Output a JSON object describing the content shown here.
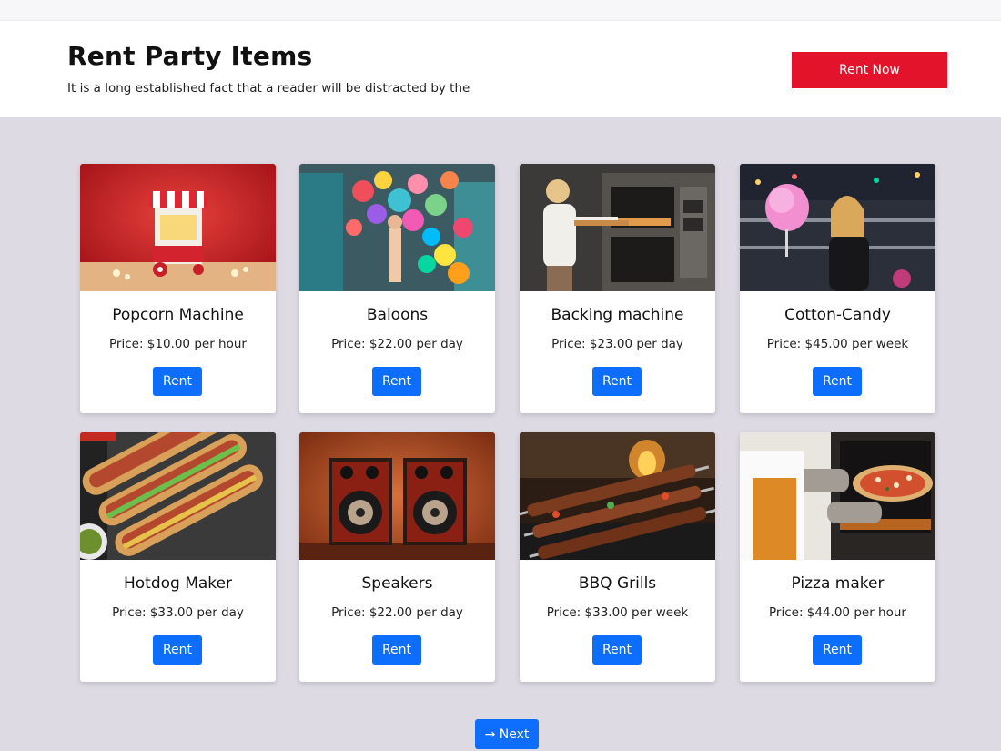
{
  "hero": {
    "title": "Rent Party Items",
    "subtitle": "It is a long established fact that a reader will be distracted by the",
    "cta_label": "Rent Now"
  },
  "colors": {
    "accent_red": "#e3132b",
    "primary_blue": "#0d6efd",
    "page_bg": "#dddae3"
  },
  "items": [
    {
      "name": "Popcorn Machine",
      "price": "Price: $10.00 per hour",
      "button": "Rent",
      "image": "popcorn-machine-photo"
    },
    {
      "name": "Baloons",
      "price": "Price: $22.00 per day",
      "button": "Rent",
      "image": "balloons-photo"
    },
    {
      "name": "Backing machine",
      "price": "Price: $23.00 per day",
      "button": "Rent",
      "image": "baking-oven-photo"
    },
    {
      "name": "Cotton-Candy",
      "price": "Price: $45.00 per week",
      "button": "Rent",
      "image": "cotton-candy-photo"
    },
    {
      "name": "Hotdog Maker",
      "price": "Price: $33.00 per day",
      "button": "Rent",
      "image": "hotdogs-photo"
    },
    {
      "name": "Speakers",
      "price": "Price: $22.00 per day",
      "button": "Rent",
      "image": "speakers-photo"
    },
    {
      "name": "BBQ Grills",
      "price": "Price: $33.00 per week",
      "button": "Rent",
      "image": "bbq-skewers-photo"
    },
    {
      "name": "Pizza maker",
      "price": "Price: $44.00 per hour",
      "button": "Rent",
      "image": "pizza-oven-photo"
    }
  ],
  "pagination": {
    "next_label": "→ Next"
  }
}
